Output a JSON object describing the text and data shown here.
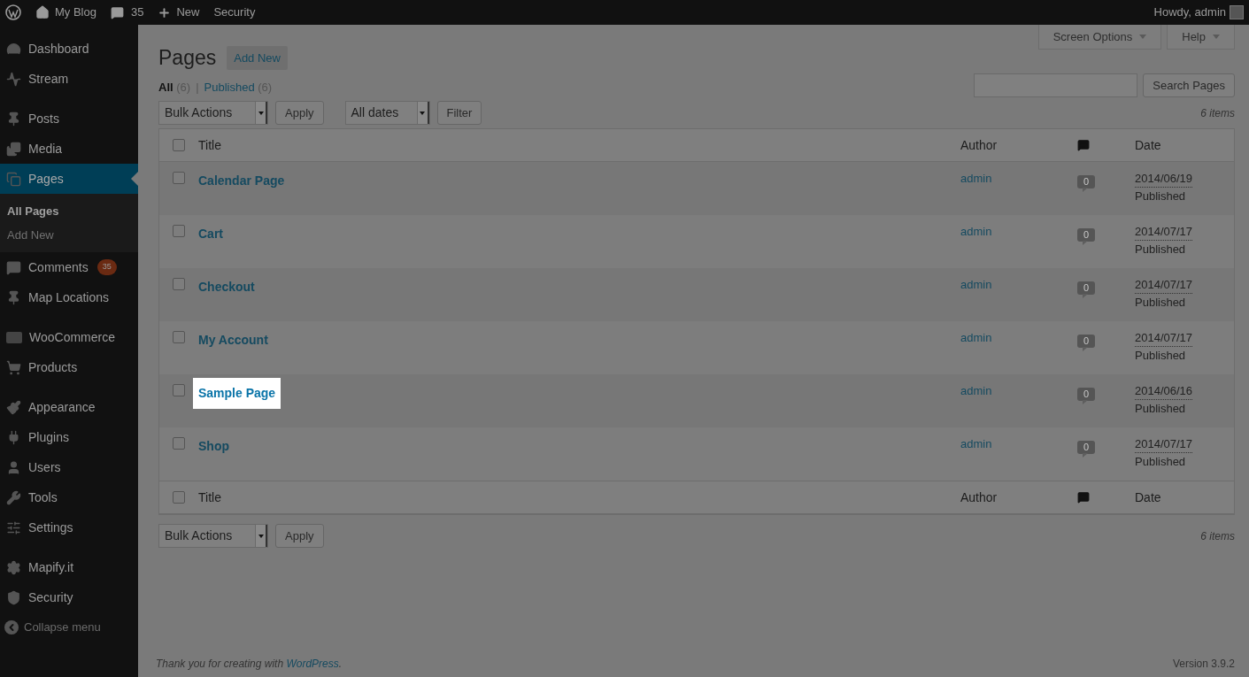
{
  "admin_bar": {
    "site": "My Blog",
    "comments_count": "35",
    "new": "New",
    "security": "Security",
    "greeting": "Howdy, admin"
  },
  "sidebar": {
    "groups": [
      [
        {
          "label": "Dashboard",
          "selected": false
        },
        {
          "label": "Stream",
          "selected": false
        }
      ],
      [
        {
          "label": "Posts",
          "selected": false
        },
        {
          "label": "Media",
          "selected": false
        },
        {
          "label": "Pages",
          "selected": true,
          "submenu": [
            {
              "label": "All Pages",
              "selected": true
            },
            {
              "label": "Add New",
              "selected": false
            }
          ]
        },
        {
          "label": "Comments",
          "selected": false,
          "badge": "35"
        },
        {
          "label": "Map Locations",
          "selected": false
        }
      ],
      [
        {
          "label": "WooCommerce",
          "selected": false
        },
        {
          "label": "Products",
          "selected": false
        }
      ],
      [
        {
          "label": "Appearance",
          "selected": false
        },
        {
          "label": "Plugins",
          "selected": false
        },
        {
          "label": "Users",
          "selected": false
        },
        {
          "label": "Tools",
          "selected": false
        },
        {
          "label": "Settings",
          "selected": false
        }
      ],
      [
        {
          "label": "Mapify.it",
          "selected": false
        },
        {
          "label": "Security",
          "selected": false
        }
      ]
    ],
    "collapse": "Collapse menu"
  },
  "header": {
    "title": "Pages",
    "add_new": "Add New",
    "screen_options": "Screen Options",
    "help": "Help"
  },
  "filter_separator": "|",
  "filters": [
    {
      "label": "All",
      "count": "(6)",
      "selected": true
    },
    {
      "label": "Published",
      "count": "(6)",
      "selected": false
    }
  ],
  "search": {
    "button": "Search Pages"
  },
  "top_actions": {
    "bulk": "Bulk Actions",
    "apply": "Apply",
    "dates": "All dates",
    "filter": "Filter",
    "count": "6 items"
  },
  "table": {
    "columns": [
      "Title",
      "Author",
      "Date"
    ],
    "header_checked": false,
    "footer_checked": false,
    "rows": [
      {
        "title": "Calendar Page",
        "author": "admin",
        "comments": "0",
        "date": "2014/06/19",
        "status": "Published",
        "highlighted": false,
        "checked": false
      },
      {
        "title": "Cart",
        "author": "admin",
        "comments": "0",
        "date": "2014/07/17",
        "status": "Published",
        "highlighted": false,
        "checked": false
      },
      {
        "title": "Checkout",
        "author": "admin",
        "comments": "0",
        "date": "2014/07/17",
        "status": "Published",
        "highlighted": false,
        "checked": false
      },
      {
        "title": "My Account",
        "author": "admin",
        "comments": "0",
        "date": "2014/07/17",
        "status": "Published",
        "highlighted": false,
        "checked": false
      },
      {
        "title": "Sample Page",
        "author": "admin",
        "comments": "0",
        "date": "2014/06/16",
        "status": "Published",
        "highlighted": true,
        "checked": false
      },
      {
        "title": "Shop",
        "author": "admin",
        "comments": "0",
        "date": "2014/07/17",
        "status": "Published",
        "highlighted": false,
        "checked": false
      }
    ],
    "footer_columns": [
      "Title",
      "Author",
      "Date"
    ]
  },
  "bottom_actions": {
    "bulk": "Bulk Actions",
    "apply": "Apply",
    "count": "6 items"
  },
  "footer": {
    "thanks": "Thank you for creating with",
    "link": "WordPress",
    "period": ".",
    "version": "Version 3.9.2"
  }
}
